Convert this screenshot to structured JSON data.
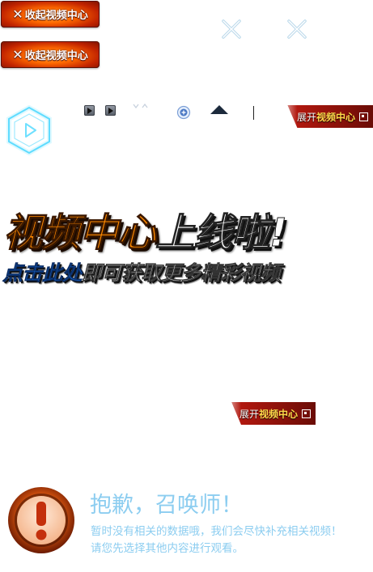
{
  "collapse_buttons": [
    {
      "label": "收起视频中心"
    },
    {
      "label": "收起视频中心"
    }
  ],
  "expand_banners": [
    {
      "label_prefix": "展开",
      "label_highlight": "视频中心"
    },
    {
      "label_prefix": "展开",
      "label_highlight": "视频中心"
    }
  ],
  "headline": {
    "orange": "视频中心",
    "white": "上线啦!"
  },
  "subline": {
    "blue": "点击此处",
    "white": "即可获取更多精彩视频"
  },
  "sorry": {
    "title": "抱歉，召唤师！",
    "line1": "暂时没有相关的数据哦，我们会尽快补充相关视频！",
    "line2": "请您先选择其他内容进行观看。"
  },
  "colors": {
    "accent_orange": "#ff8a00",
    "accent_blue": "#1a6fd8",
    "sorry_text": "#8ccdf0",
    "banner_red": "#b1180f",
    "hex_cyan": "#7fe6ff"
  },
  "icons": [
    "close-icon",
    "play-hex-icon",
    "arrow-right-icon",
    "chevron-icon",
    "plus-circle-icon",
    "triangle-up-icon",
    "expand-icon",
    "exclamation-icon"
  ]
}
